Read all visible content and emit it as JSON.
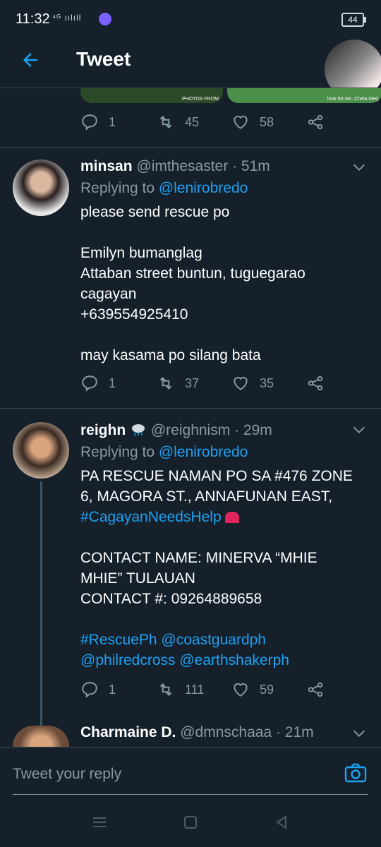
{
  "status": {
    "time": "11:32",
    "signal": "⁴ᴳ ıılıll",
    "battery": "44"
  },
  "appbar": {
    "title": "Tweet"
  },
  "prev_media": {
    "caption1": "PHOTOS FROM",
    "caption2": "look for Ms. Chela Meq"
  },
  "prev_tweet": {
    "replies": "1",
    "retweets": "45",
    "likes": "58"
  },
  "tweets": [
    {
      "name": "minsan",
      "handle": "@imthesaster",
      "time": "· 51m",
      "replying_prefix": "Replying to ",
      "replying_to": "@lenirobredo",
      "lines": [
        "please send rescue po",
        "",
        "Emilyn bumanglag",
        "Attaban street buntun, tuguegarao",
        "cagayan",
        "+639554925410",
        "",
        "may kasama po silang bata"
      ],
      "replies": "1",
      "retweets": "37",
      "likes": "35"
    },
    {
      "name": "reighn",
      "handle": "@reighnism",
      "time": "· 29m",
      "replying_prefix": "Replying to ",
      "replying_to": "@lenirobredo",
      "line1": "PA RESCUE NAMAN PO SA #476 ZONE",
      "line2": "6, MAGORA ST., ANNAFUNAN EAST,",
      "hashtag": "#CagayanNeedsHelp",
      "line4": "CONTACT NAME: MINERVA “MHIE",
      "line5": "MHIE” TULAUAN",
      "line6": "CONTACT #: 09264889658",
      "tags1": "#RescuePh @coastguardph",
      "tags2": "@philredcross @earthshakerph",
      "replies": "1",
      "retweets": "111",
      "likes": "59"
    },
    {
      "name": "Charmaine D.",
      "handle": "@dmnschaaa",
      "time": "· 21m"
    }
  ],
  "compose": {
    "placeholder": "Tweet your reply"
  },
  "colors": {
    "background": "#15202b",
    "accent": "#1da1f2",
    "muted": "#8899a6",
    "divider": "#38444d"
  }
}
